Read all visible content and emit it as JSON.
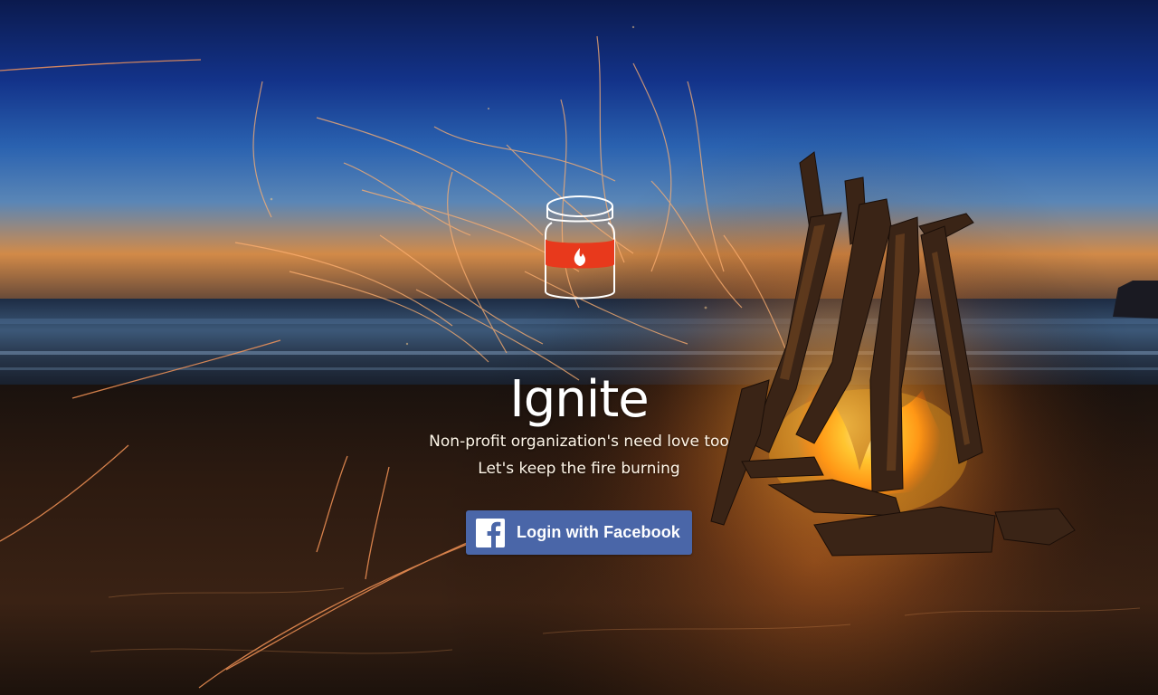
{
  "app": {
    "title": "Ignite",
    "tagline_line1": "Non-profit organization's need love too",
    "tagline_line2": "Let's keep the fire burning"
  },
  "login": {
    "button_label": "Login with Facebook",
    "icon": "facebook-icon"
  },
  "logo": {
    "icon": "jar-with-flame-icon"
  },
  "colors": {
    "facebook_blue": "#4a66a8",
    "logo_red": "#e8391c",
    "sky_top": "#0d1f5c",
    "sky_horizon": "#e89a4a",
    "fire": "#ffb020"
  }
}
